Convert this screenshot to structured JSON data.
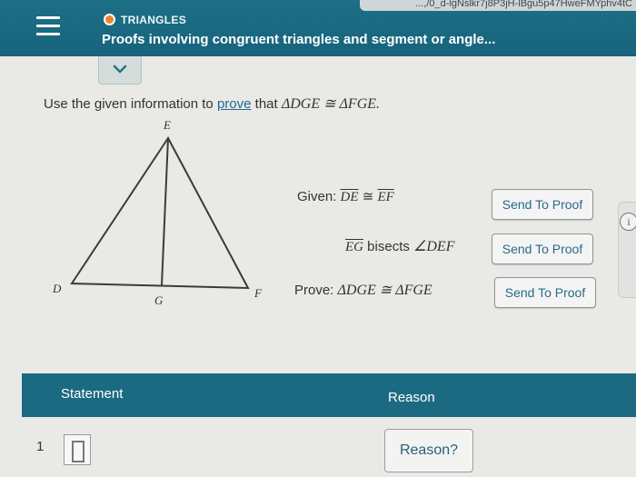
{
  "header": {
    "url_fragment": "...,/0_d-lgNslkr7j8P3jH-lBgu5p47HweFMYphv4tC",
    "topic": "TRIANGLES",
    "title": "Proofs involving congruent triangles and segment or angle..."
  },
  "instruction": {
    "prefix": "Use the given information to",
    "link": "prove",
    "middle": "that",
    "statement": "ΔDGE ≅ ΔFGE."
  },
  "triangle": {
    "labels": {
      "top": "E",
      "left": "D",
      "right": "F",
      "bottom": "G"
    }
  },
  "given": {
    "row1": {
      "label": "Given:",
      "seg_a": "DE",
      "rel": "≅",
      "seg_b": "EF",
      "button": "Send To Proof"
    },
    "row2": {
      "seg": "EG",
      "text": "bisects",
      "angle": "∠DEF",
      "button": "Send To Proof"
    },
    "row3": {
      "label": "Prove:",
      "expr": "ΔDGE ≅ ΔFGE",
      "button": "Send To Proof"
    }
  },
  "table": {
    "col_statement": "Statement",
    "col_reason": "Reason",
    "rows": [
      {
        "number": "1",
        "reason_button": "Reason?"
      }
    ]
  },
  "colors": {
    "header": "#1c6a82",
    "accent_dot": "#e8872d",
    "link": "#226b96"
  }
}
